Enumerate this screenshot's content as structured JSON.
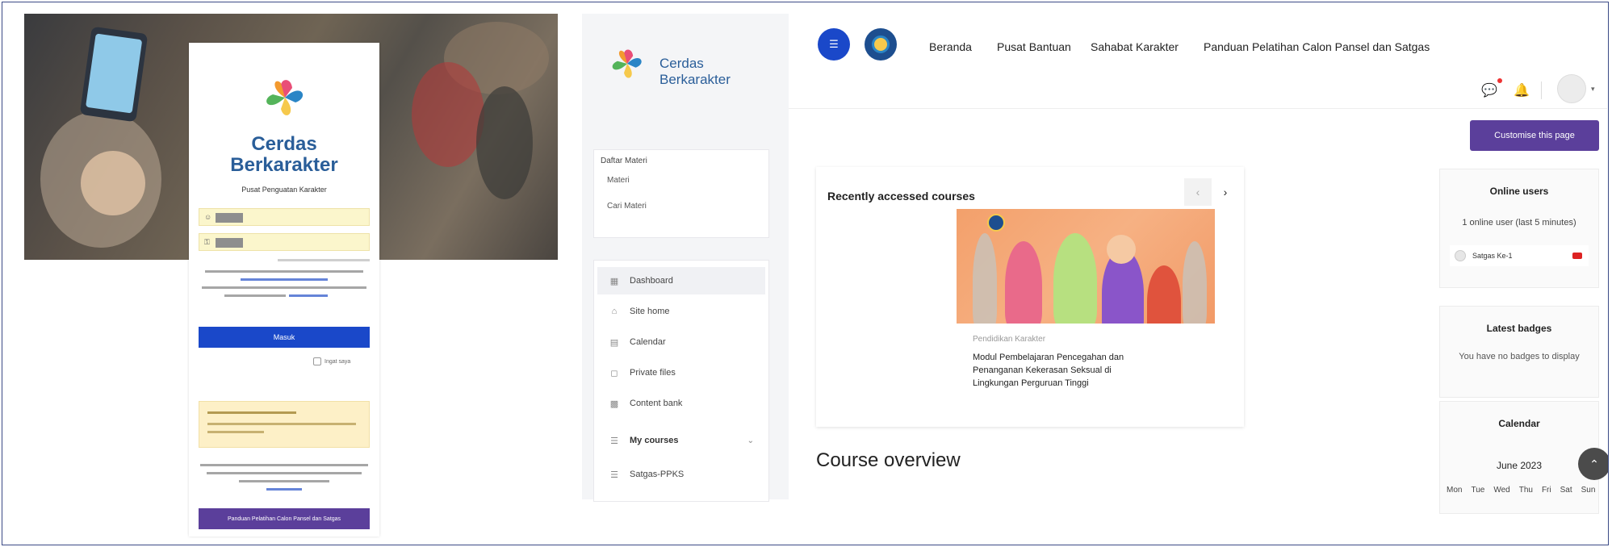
{
  "login": {
    "brand_line1": "Cerdas",
    "brand_line2": "Berkarakter",
    "subtitle": "Pusat Penguatan Karakter",
    "username_icon": "user-icon",
    "password_icon": "lock-icon",
    "login_button": "Masuk",
    "remember_label": "Ingat saya",
    "guide_button": "Panduan Pelatihan Calon Pansel dan Satgas"
  },
  "sidebar": {
    "brand_line1": "Cerdas",
    "brand_line2": "Berkarakter",
    "materi": {
      "heading": "Daftar Materi",
      "items": [
        "Materi",
        "Cari Materi"
      ]
    },
    "nav": [
      {
        "label": "Dashboard",
        "icon": "dashboard-icon"
      },
      {
        "label": "Site home",
        "icon": "home-icon"
      },
      {
        "label": "Calendar",
        "icon": "calendar-icon"
      },
      {
        "label": "Private files",
        "icon": "file-icon"
      },
      {
        "label": "Content bank",
        "icon": "content-bank-icon"
      },
      {
        "label": "My courses",
        "icon": "graduation-icon"
      },
      {
        "label": "Satgas-PPKS",
        "icon": "course-icon"
      }
    ]
  },
  "topbar": {
    "nav": [
      "Beranda",
      "Pusat Bantuan",
      "Sahabat Karakter",
      "Panduan Pelatihan Calon Pansel dan Satgas"
    ],
    "customise_button": "Customise this page"
  },
  "recent": {
    "title": "Recently accessed courses",
    "course_category": "Pendidikan Karakter",
    "course_name_lines": [
      "Modul Pembelajaran Pencegahan dan",
      "Penanganan Kekerasan Seksual di",
      "Lingkungan Perguruan Tinggi"
    ]
  },
  "overview": {
    "title": "Course overview"
  },
  "blocks": {
    "online": {
      "title": "Online users",
      "subtitle": "1 online user (last 5 minutes)",
      "user": "Satgas Ke-1"
    },
    "badges": {
      "title": "Latest badges",
      "subtitle": "You have no badges to display"
    },
    "calendar": {
      "title": "Calendar",
      "month": "June 2023",
      "days": [
        "Mon",
        "Tue",
        "Wed",
        "Thu",
        "Fri",
        "Sat",
        "Sun"
      ]
    }
  },
  "colors": {
    "primary_blue": "#1a48c9",
    "purple": "#5b3f9b",
    "brand_text": "#2a5e99"
  }
}
